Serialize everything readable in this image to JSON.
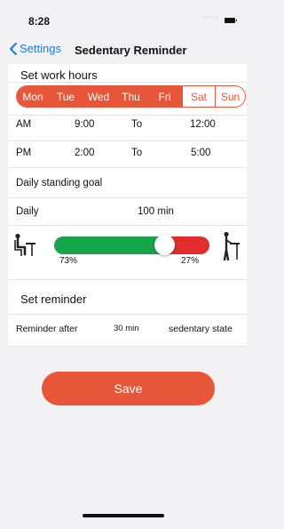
{
  "status": {
    "time": "8:28",
    "signal": "....."
  },
  "nav": {
    "back_label": "Settings",
    "title": "Sedentary Reminder"
  },
  "work_hours": {
    "title": "Set work hours",
    "days": [
      {
        "label": "Mon",
        "selected": true
      },
      {
        "label": "Tue",
        "selected": true
      },
      {
        "label": "Wed",
        "selected": true
      },
      {
        "label": "Thu",
        "selected": true
      },
      {
        "label": "Fri",
        "selected": true
      },
      {
        "label": "Sat",
        "selected": false
      },
      {
        "label": "Sun",
        "selected": false
      }
    ],
    "am": {
      "label": "AM",
      "from": "9:00",
      "to_label": "To",
      "to": "12:00"
    },
    "pm": {
      "label": "PM",
      "from": "2:00",
      "to_label": "To",
      "to": "5:00"
    }
  },
  "goal": {
    "title": "Daily standing goal",
    "daily_label": "Daily",
    "daily_value": "100 min",
    "sit_percent": 73,
    "sit_label": "73%",
    "stand_label": "27%",
    "sit_icon": "person-sitting-icon",
    "stand_icon": "person-standing-icon"
  },
  "reminder": {
    "title": "Set reminder",
    "label": "Reminder after",
    "value": "30 min",
    "state": "sedentary state"
  },
  "save_label": "Save",
  "colors": {
    "accent": "#e8563a",
    "link": "#1a7ae6",
    "sit": "#16a54a",
    "stand": "#e32c2c"
  }
}
